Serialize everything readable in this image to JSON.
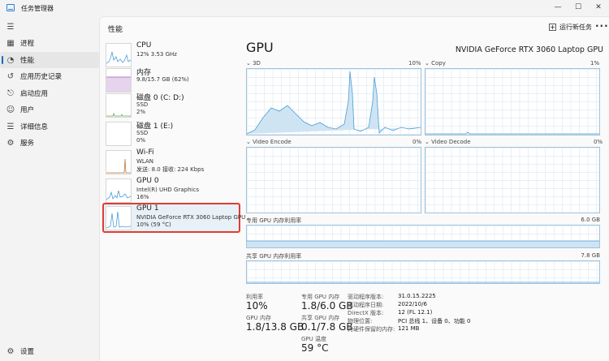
{
  "window": {
    "title": "任务管理器",
    "minimize": "—",
    "maximize": "☐",
    "close": "✕"
  },
  "nav": {
    "items": [
      {
        "label": "进程",
        "icon": "processes-icon",
        "glyph": "▦"
      },
      {
        "label": "性能",
        "icon": "performance-icon",
        "glyph": "◔"
      },
      {
        "label": "应用历史记录",
        "icon": "app-history-icon",
        "glyph": "↺"
      },
      {
        "label": "启动应用",
        "icon": "startup-icon",
        "glyph": "⎋"
      },
      {
        "label": "用户",
        "icon": "users-icon",
        "glyph": "☺"
      },
      {
        "label": "详细信息",
        "icon": "details-icon",
        "glyph": "☰"
      },
      {
        "label": "服务",
        "icon": "services-icon",
        "glyph": "⚙"
      }
    ],
    "settings": {
      "label": "设置",
      "icon": "settings-icon",
      "glyph": "⚙"
    },
    "menu_glyph": "☰"
  },
  "header": {
    "title": "性能",
    "run_task": "运行新任务",
    "more": "···"
  },
  "devices": [
    {
      "name": "CPU",
      "line1": "12% 3.53 GHz",
      "line2": ""
    },
    {
      "name": "内存",
      "line1": "9.8/15.7 GB (62%)",
      "line2": ""
    },
    {
      "name": "磁盘 0 (C: D:)",
      "line1": "SSD",
      "line2": "2%"
    },
    {
      "name": "磁盘 1 (E:)",
      "line1": "SSD",
      "line2": "0%"
    },
    {
      "name": "Wi-Fi",
      "line1": "WLAN",
      "line2": "发送: 8.0 接收: 224 Kbps"
    },
    {
      "name": "GPU 0",
      "line1": "Intel(R) UHD Graphics",
      "line2": "16%"
    },
    {
      "name": "GPU 1",
      "line1": "NVIDIA GeForce RTX 3060 Laptop GPU",
      "line2": "10% (59 °C)"
    }
  ],
  "detail": {
    "title": "GPU",
    "model": "NVIDIA GeForce RTX 3060 Laptop GPU",
    "engines": [
      {
        "label": "3D",
        "pct": "10%"
      },
      {
        "label": "Copy",
        "pct": "1%"
      },
      {
        "label": "Video Encode",
        "pct": "0%"
      },
      {
        "label": "Video Decode",
        "pct": "0%"
      }
    ],
    "dedicated_label": "专用 GPU 内存利用率",
    "dedicated_max": "6.0 GB",
    "shared_label": "共享 GPU 内存利用率",
    "shared_max": "7.8 GB",
    "stats": {
      "util_label": "利用率",
      "util_value": "10%",
      "ded_label": "专用 GPU 内存",
      "ded_value": "1.8/6.0 GB",
      "gpumem_label": "GPU 内存",
      "gpumem_value": "1.8/13.8 GB",
      "shared_label": "共享 GPU 内存",
      "shared_value": "0.1/7.8 GB",
      "temp_label": "GPU 温度",
      "temp_value": "59 °C"
    },
    "info": [
      {
        "k": "驱动程序版本:",
        "v": "31.0.15.2225"
      },
      {
        "k": "驱动程序日期:",
        "v": "2022/10/6"
      },
      {
        "k": "DirectX 版本:",
        "v": "12 (FL 12.1)"
      },
      {
        "k": "物理位置:",
        "v": "PCI 总线 1、设备 0、功能 0"
      },
      {
        "k": "为硬件保留的内存:",
        "v": "121 MB"
      }
    ]
  },
  "colors": {
    "accent": "#0f6cbd",
    "graph_line": "#4a9ed6",
    "selection_border": "#e03c31"
  }
}
